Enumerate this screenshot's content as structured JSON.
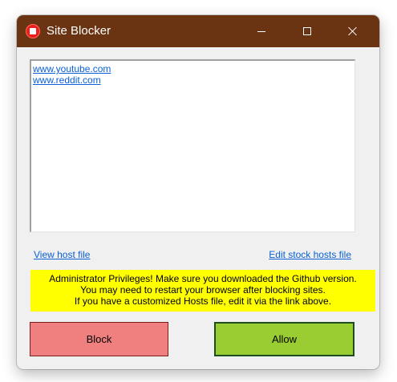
{
  "window": {
    "title": "Site Blocker",
    "icon": "stop-icon",
    "titlebar_color": "#6a3412"
  },
  "sites": [
    "www.youtube.com",
    "www.reddit.com"
  ],
  "links": {
    "view_host": "View host file",
    "edit_stock": "Edit stock hosts file"
  },
  "notice": {
    "lines": [
      "Administrator Privileges! Make sure you downloaded the Github version.",
      "You may need to restart your browser after blocking sites.",
      "If you have a customized Hosts file, edit it via the link above."
    ],
    "background": "#ffff00"
  },
  "buttons": {
    "block": "Block",
    "allow": "Allow",
    "block_color": "#f08080",
    "allow_color": "#9acd32"
  }
}
